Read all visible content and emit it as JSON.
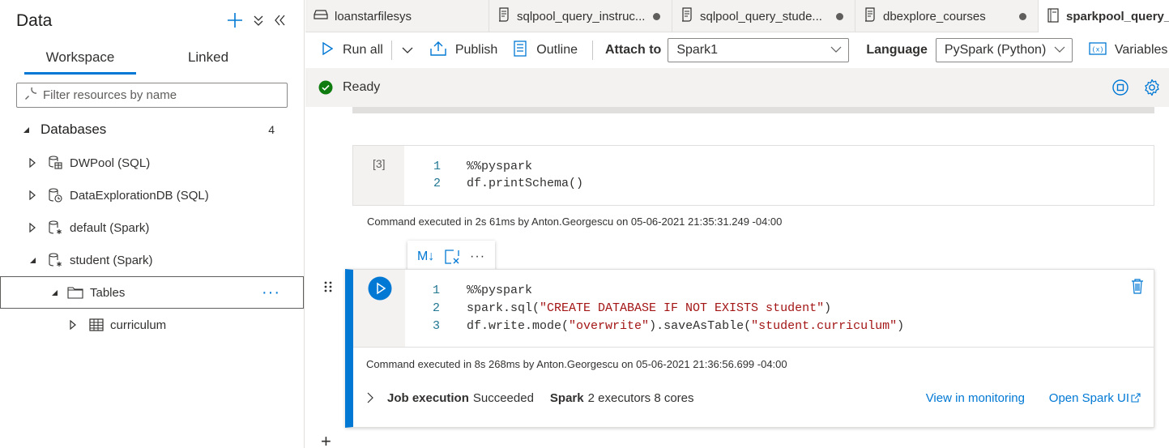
{
  "left_panel": {
    "title": "Data",
    "tabs": {
      "workspace": "Workspace",
      "linked": "Linked"
    },
    "filter_placeholder": "Filter resources by name",
    "databases": {
      "label": "Databases",
      "count": "4"
    },
    "items": [
      {
        "label": "DWPool (SQL)"
      },
      {
        "label": "DataExplorationDB (SQL)"
      },
      {
        "label": "default (Spark)"
      },
      {
        "label": "student (Spark)"
      }
    ],
    "tables_label": "Tables",
    "table_item": "curriculum",
    "more": "···"
  },
  "file_tabs": [
    {
      "label": "loanstarfilesys"
    },
    {
      "label": "sqlpool_query_instruc..."
    },
    {
      "label": "sqlpool_query_stude..."
    },
    {
      "label": "dbexplore_courses"
    },
    {
      "label": "sparkpool_query_c"
    }
  ],
  "toolbar": {
    "run_all": "Run all",
    "publish": "Publish",
    "outline": "Outline",
    "attach_to_label": "Attach to",
    "attach_to_value": "Spark1",
    "language_label": "Language",
    "language_value": "PySpark (Python)",
    "variables": "Variables"
  },
  "status": {
    "text": "Ready"
  },
  "cell1": {
    "exec_count": "[3]",
    "lines": [
      {
        "num": "1",
        "text": "%%pyspark"
      },
      {
        "num": "2",
        "text": "df.printSchema()"
      }
    ],
    "exec_info": "Command executed in 2s 61ms by Anton.Georgescu on 05-06-2021 21:35:31.249 -04:00"
  },
  "cell2": {
    "toolbar": {
      "markdown": "M↓",
      "more": "···"
    },
    "lines": [
      {
        "num": "1",
        "code": "%%pyspark"
      },
      {
        "num": "2",
        "pre": "spark.sql(",
        "str": "\"CREATE DATABASE IF NOT EXISTS student\"",
        "post": ")"
      },
      {
        "num": "3",
        "pre": "df.write.mode(",
        "str": "\"overwrite\"",
        "mid": ").saveAsTable(",
        "str2": "\"student.curriculum\"",
        "post": ")"
      }
    ],
    "exec_info": "Command executed in 8s 268ms by Anton.Georgescu on 05-06-2021 21:36:56.699 -04:00",
    "job_label": "Job execution",
    "job_status": "Succeeded",
    "spark_label": "Spark",
    "spark_detail": "2 executors 8 cores",
    "view_monitoring": "View in monitoring",
    "open_spark_ui": "Open Spark UI"
  },
  "add_cell": "+",
  "colors": {
    "accent": "#0078d4",
    "success": "#107c10",
    "string": "#a31515",
    "line_number": "#237893"
  }
}
